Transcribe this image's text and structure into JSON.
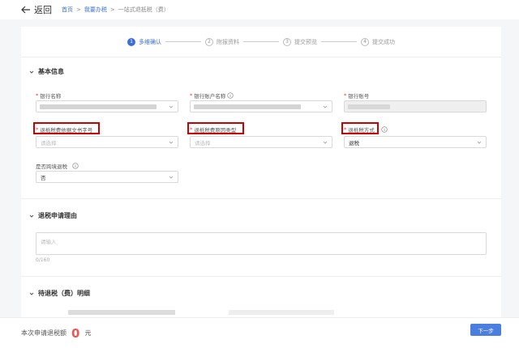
{
  "header": {
    "back_label": "返回",
    "breadcrumbs": [
      "首页",
      "我要办税",
      "一站式退抵税（费）"
    ],
    "breadcrumb_sep": ">"
  },
  "steps": [
    {
      "num": "1",
      "label": "多维确认",
      "active": true
    },
    {
      "num": "2",
      "label": "附报资料",
      "active": false
    },
    {
      "num": "3",
      "label": "提交预览",
      "active": false
    },
    {
      "num": "4",
      "label": "提交成功",
      "active": false
    }
  ],
  "basic_info": {
    "title": "基本信息",
    "bank_name_label": "银行名称",
    "bank_account_name_label": "银行账户名称",
    "bank_account_no_label": "银行账号",
    "refund_doc_no_label": "退抵税费依据文书字号",
    "refund_doc_no_placeholder": "请选择",
    "refund_reason_type_label": "退抵税费原因类型",
    "refund_reason_type_placeholder": "请选择",
    "refund_method_label": "退抵税方式",
    "refund_method_value": "退税",
    "cross_region_label": "是否跨境退税",
    "cross_region_value": "否",
    "required_mark": "*"
  },
  "reason": {
    "title": "退税申请理由",
    "placeholder": "请输入",
    "counter": "0/160"
  },
  "details": {
    "title": "待退税（费）明细"
  },
  "footer": {
    "amount_label": "本次申请退税额",
    "amount_value": "0",
    "unit": "元",
    "next_label": "下一步"
  },
  "colors": {
    "accent": "#3a6fd8",
    "highlight_box": "#cc0000",
    "amount": "#e55555"
  }
}
